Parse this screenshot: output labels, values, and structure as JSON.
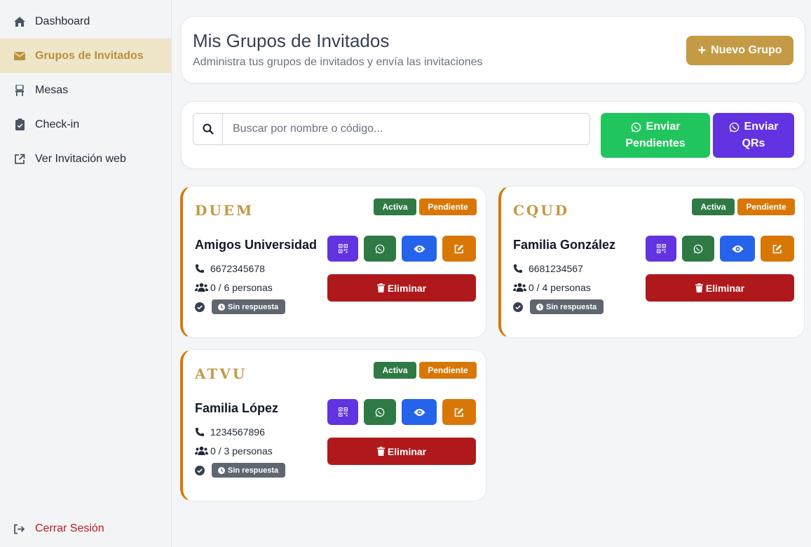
{
  "sidebar": {
    "items": [
      {
        "label": "Dashboard",
        "icon": "home-icon"
      },
      {
        "label": "Grupos de Invitados",
        "icon": "envelope-icon",
        "active": true
      },
      {
        "label": "Mesas",
        "icon": "chair-icon"
      },
      {
        "label": "Check-in",
        "icon": "clipboard-check-icon"
      },
      {
        "label": "Ver Invitación web",
        "icon": "external-link-icon"
      }
    ],
    "logout_label": "Cerrar Sesión"
  },
  "header": {
    "title": "Mis Grupos de Invitados",
    "subtitle": "Administra tus grupos de invitados y envía las invitaciones",
    "new_group_label": "Nuevo Grupo"
  },
  "search": {
    "placeholder": "Buscar por nombre o código...",
    "value": ""
  },
  "send_buttons": {
    "pending_line1": "Enviar",
    "pending_line2": "Pendientes",
    "qr_line1": "Enviar",
    "qr_line2": "QRs"
  },
  "groups": [
    {
      "code": "DUEM",
      "name": "Amigos Universidad",
      "phone": "6672345678",
      "people": "0 / 6 personas",
      "status_badge": "Activa",
      "invite_badge": "Pendiente",
      "response": "Sin respuesta",
      "delete_label": "Eliminar"
    },
    {
      "code": "CQUD",
      "name": "Familia González",
      "phone": "6681234567",
      "people": "0 / 4 personas",
      "status_badge": "Activa",
      "invite_badge": "Pendiente",
      "response": "Sin respuesta",
      "delete_label": "Eliminar"
    },
    {
      "code": "ATVU",
      "name": "Familia López",
      "phone": "1234567896",
      "people": "0 / 3 personas",
      "status_badge": "Activa",
      "invite_badge": "Pendiente",
      "response": "Sin respuesta",
      "delete_label": "Eliminar"
    }
  ],
  "colors": {
    "accent_gold": "#c49a45",
    "active_nav_bg": "#efe5c9",
    "whatsapp_green": "#21c55d",
    "qr_purple": "#6233e0",
    "badge_green": "#2f7a44",
    "badge_orange": "#d97706",
    "view_blue": "#2563eb",
    "delete_red": "#b0191c",
    "logout_red": "#b91c1c"
  }
}
